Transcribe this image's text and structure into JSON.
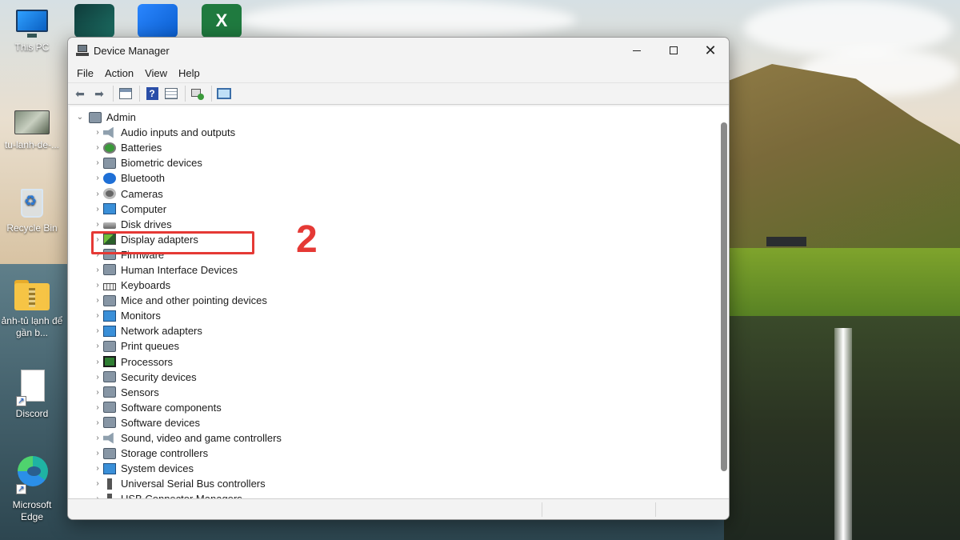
{
  "desktop": {
    "icons": [
      {
        "label": "This PC"
      },
      {
        "label": "tu-lanh-de-..."
      },
      {
        "label": "Recycle Bin"
      },
      {
        "label": "ảnh-tủ lạnh để gần b..."
      },
      {
        "label": "Discord"
      },
      {
        "label": "Microsoft Edge"
      }
    ]
  },
  "window": {
    "title": "Device Manager",
    "menu": [
      "File",
      "Action",
      "View",
      "Help"
    ],
    "root": "Admin",
    "devices": [
      "Audio inputs and outputs",
      "Batteries",
      "Biometric devices",
      "Bluetooth",
      "Cameras",
      "Computer",
      "Disk drives",
      "Display adapters",
      "Firmware",
      "Human Interface Devices",
      "Keyboards",
      "Mice and other pointing devices",
      "Monitors",
      "Network adapters",
      "Print queues",
      "Processors",
      "Security devices",
      "Sensors",
      "Software components",
      "Software devices",
      "Sound, video and game controllers",
      "Storage controllers",
      "System devices",
      "Universal Serial Bus controllers",
      "USB Connector Managers"
    ]
  },
  "annotation": {
    "step": "2",
    "highlighted_item": "Display adapters",
    "color": "#e53935"
  },
  "colors": {
    "accent": "#e53935",
    "window_bg": "#f3f3f3"
  }
}
